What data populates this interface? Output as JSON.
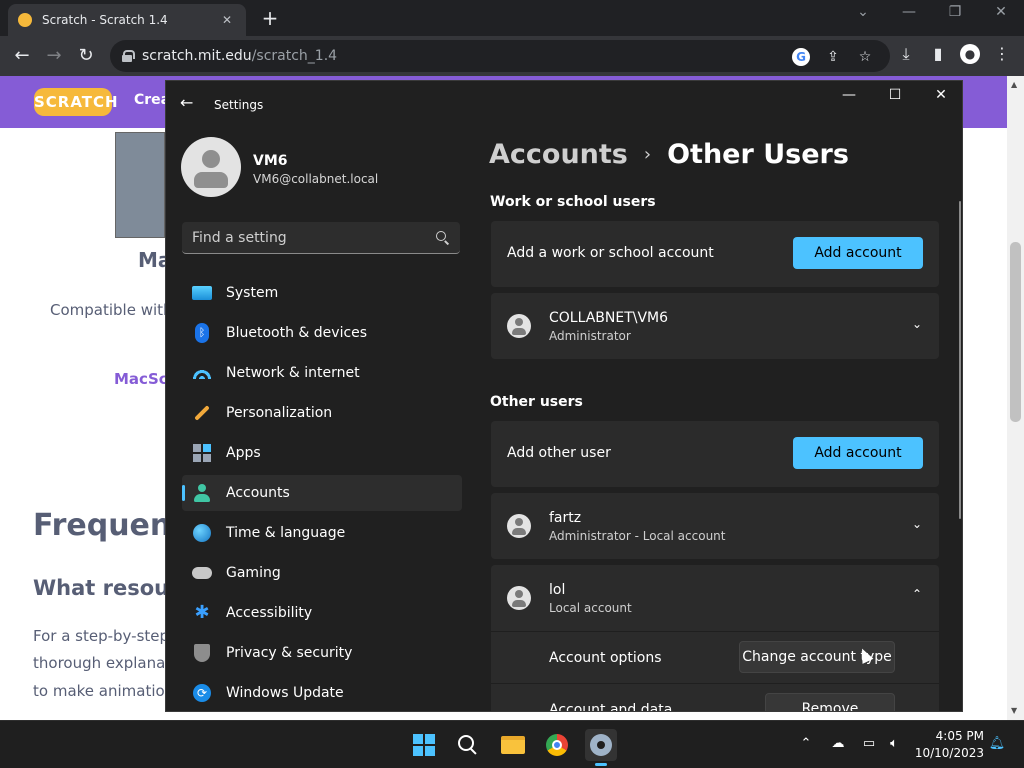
{
  "browser": {
    "tab_title": "Scratch - Scratch 1.4",
    "url_host": "scratch.mit.edu",
    "url_path": "/scratch_1.4"
  },
  "webpage": {
    "logo_text": "SCRATCH",
    "create_label": "Crea",
    "heading_partial": "Ma",
    "compat_text": "Compatible with",
    "macsc_link": "MacSc",
    "faq_heading": "Frequent",
    "what_heading": "What resour",
    "para_line1": "For a step-by-step",
    "para_line2": "thorough explanati",
    "para_line3": "to make animation"
  },
  "settings": {
    "window_title": "Settings",
    "profile": {
      "name": "VM6",
      "email": "VM6@collabnet.local"
    },
    "search": {
      "placeholder": "Find a setting"
    },
    "nav": [
      {
        "label": "System"
      },
      {
        "label": "Bluetooth & devices"
      },
      {
        "label": "Network & internet"
      },
      {
        "label": "Personalization"
      },
      {
        "label": "Apps"
      },
      {
        "label": "Accounts"
      },
      {
        "label": "Time & language"
      },
      {
        "label": "Gaming"
      },
      {
        "label": "Accessibility"
      },
      {
        "label": "Privacy & security"
      },
      {
        "label": "Windows Update"
      }
    ],
    "active_nav": "Accounts",
    "breadcrumb": {
      "parent": "Accounts",
      "current": "Other Users"
    },
    "work_section": {
      "title": "Work or school users",
      "add_label": "Add a work or school account",
      "add_button": "Add account",
      "users": [
        {
          "name": "COLLABNET\\VM6",
          "subtitle": "Administrator"
        }
      ]
    },
    "other_section": {
      "title": "Other users",
      "add_label": "Add other user",
      "add_button": "Add account",
      "users": [
        {
          "name": "fartz",
          "subtitle": "Administrator - Local account",
          "expanded": false
        },
        {
          "name": "lol",
          "subtitle": "Local account",
          "expanded": true
        }
      ],
      "expanded_options": {
        "account_options_label": "Account options",
        "change_button": "Change account type",
        "account_data_label": "Account and data",
        "remove_button": "Remove"
      }
    },
    "accent_color": "#4cc2ff"
  },
  "taskbar": {
    "time": "4:05 PM",
    "date": "10/10/2023",
    "apps": [
      "start-icon",
      "search-icon",
      "file-explorer-icon",
      "chrome-icon",
      "settings-icon"
    ]
  }
}
